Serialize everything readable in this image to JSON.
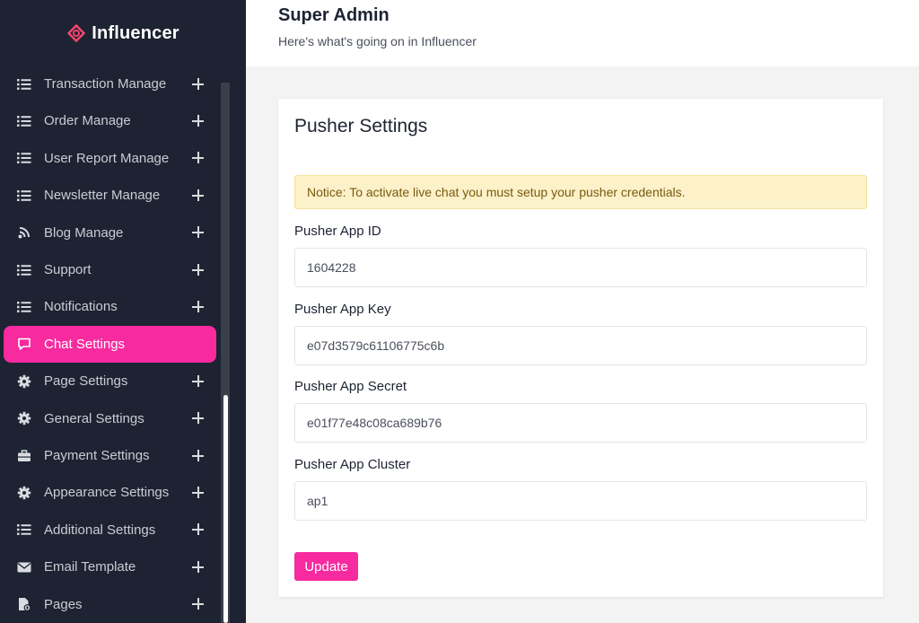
{
  "brand": {
    "name": "Influencer",
    "accent": "#f72a9f"
  },
  "header": {
    "title": "Super Admin",
    "subtitle": "Here's what's going on in Influencer"
  },
  "sidebar": {
    "items": [
      {
        "label": "Transaction Manage",
        "icon": "list-icon",
        "active": false,
        "expandable": true
      },
      {
        "label": "Order Manage",
        "icon": "list-icon",
        "active": false,
        "expandable": true
      },
      {
        "label": "User Report Manage",
        "icon": "list-icon",
        "active": false,
        "expandable": true
      },
      {
        "label": "Newsletter Manage",
        "icon": "list-icon",
        "active": false,
        "expandable": true
      },
      {
        "label": "Blog Manage",
        "icon": "blog-icon",
        "active": false,
        "expandable": true
      },
      {
        "label": "Support",
        "icon": "list-icon",
        "active": false,
        "expandable": true
      },
      {
        "label": "Notifications",
        "icon": "list-icon",
        "active": false,
        "expandable": true
      },
      {
        "label": "Chat Settings",
        "icon": "chat-icon",
        "active": true,
        "expandable": false
      },
      {
        "label": "Page Settings",
        "icon": "gear-icon",
        "active": false,
        "expandable": true
      },
      {
        "label": "General Settings",
        "icon": "gear-icon",
        "active": false,
        "expandable": true
      },
      {
        "label": "Payment Settings",
        "icon": "briefcase-icon",
        "active": false,
        "expandable": true
      },
      {
        "label": "Appearance Settings",
        "icon": "gear-icon",
        "active": false,
        "expandable": true
      },
      {
        "label": "Additional Settings",
        "icon": "list-icon",
        "active": false,
        "expandable": true
      },
      {
        "label": "Email Template",
        "icon": "envelope-icon",
        "active": false,
        "expandable": true
      },
      {
        "label": "Pages",
        "icon": "file-icon",
        "active": false,
        "expandable": true
      }
    ]
  },
  "card": {
    "title": "Pusher Settings",
    "notice": "Notice: To activate live chat you must setup your pusher credentials.",
    "fields": [
      {
        "label": "Pusher App ID",
        "value": "1604228"
      },
      {
        "label": "Pusher App Key",
        "value": "e07d3579c61106775c6b"
      },
      {
        "label": "Pusher App Secret",
        "value": "e01f77e48c08ca689b76"
      },
      {
        "label": "Pusher App Cluster",
        "value": "ap1"
      }
    ],
    "submit_label": "Update"
  }
}
